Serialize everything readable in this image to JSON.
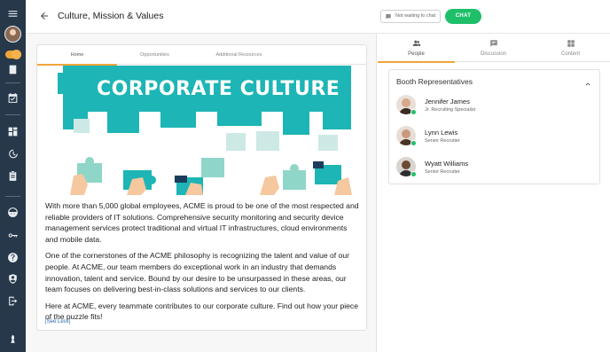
{
  "header": {
    "title": "Culture, Mission & Values",
    "status_label": "Not waiting to chat",
    "chat_label": "CHAT"
  },
  "main_tabs": [
    {
      "label": "Home",
      "active": true
    },
    {
      "label": "Opportunities",
      "active": false
    },
    {
      "label": "Additional Resources",
      "active": false
    }
  ],
  "banner": {
    "title": "CORPORATE CULTURE"
  },
  "content": {
    "paragraphs": [
      "With more than 5,000 global employees, ACME is proud to be one of the most respected and reliable providers of IT solutions. Comprehensive security monitoring and security device management services protect traditional and virtual IT infrastructures, cloud environments and mobile data.",
      "One of the cornerstones of the ACME philosophy is recognizing the talent and value of our people. At ACME, our team members do exceptional work in an industry that demands innovation, talent and service. Bound by our desire to be unsurpassed in these areas, our team focuses on delivering best-in-class solutions and services to our clients.",
      "Here at ACME, every teammate contributes to our corporate culture. Find out how your piece of the puzzle fits!"
    ],
    "see_less": "[See Less]"
  },
  "side_tabs": [
    {
      "label": "People",
      "icon": "people-icon",
      "active": true
    },
    {
      "label": "Discussion",
      "icon": "discussion-icon",
      "active": false
    },
    {
      "label": "Content",
      "icon": "content-icon",
      "active": false
    }
  ],
  "booth": {
    "title": "Booth Representatives",
    "reps": [
      {
        "name": "Jennifer James",
        "role": "Jr. Recruiting Specialist"
      },
      {
        "name": "Lynn Lewis",
        "role": "Senior Recruiter"
      },
      {
        "name": "Wyatt Williams",
        "role": "Senior Recruiter"
      }
    ]
  },
  "colors": {
    "rail": "#27384a",
    "accent": "#f0a63a",
    "chat": "#1fbf6a",
    "banner": "#1db5b5",
    "link": "#2a6bb3"
  }
}
